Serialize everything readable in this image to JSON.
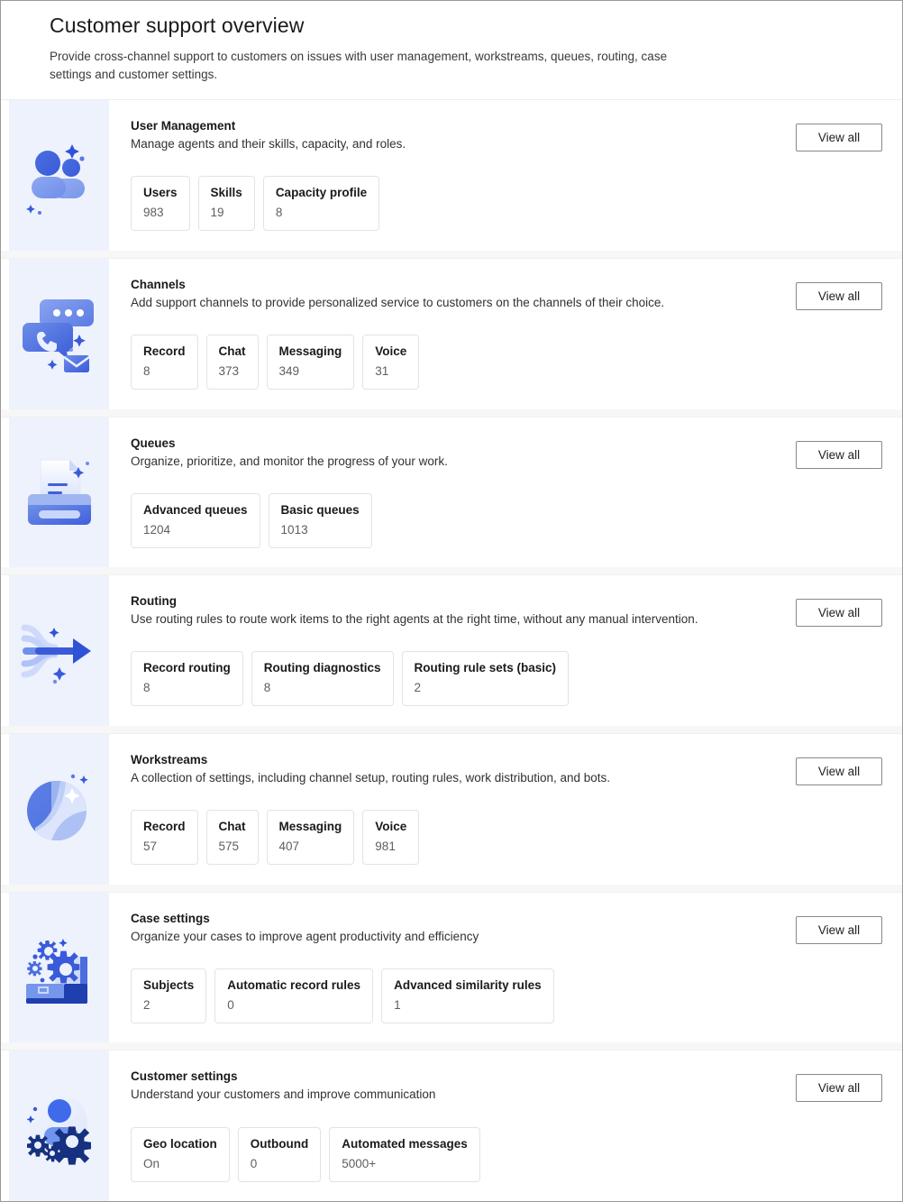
{
  "header": {
    "title": "Customer support overview",
    "subtitle": "Provide cross-channel support to customers on issues with user management, workstreams, queues, routing, case settings and customer settings."
  },
  "colors": {
    "accent": "#3a5bd9",
    "accent_light": "#7e9bf0",
    "icon_panel_bg": "#eef2fd",
    "card_bg": "#ffffff",
    "page_bg": "#f7f7f7",
    "title_text": "#1b1a19",
    "value_text": "#605e5c",
    "tile_border": "#e3e3e3",
    "button_border": "#8a8886"
  },
  "common": {
    "view_all_label": "View all"
  },
  "cards": [
    {
      "id": "user-management",
      "icon": "people-icon",
      "title": "User Management",
      "description": "Manage agents and their skills, capacity, and roles.",
      "view_all_label": "View all",
      "stats": [
        {
          "label": "Users",
          "value": "983"
        },
        {
          "label": "Skills",
          "value": "19"
        },
        {
          "label": "Capacity profile",
          "value": "8"
        }
      ]
    },
    {
      "id": "channels",
      "icon": "chat-call-mail-icon",
      "title": "Channels",
      "description": "Add support channels to provide personalized service to customers on the channels of their choice.",
      "view_all_label": "View all",
      "stats": [
        {
          "label": "Record",
          "value": "8"
        },
        {
          "label": "Chat",
          "value": "373"
        },
        {
          "label": "Messaging",
          "value": "349"
        },
        {
          "label": "Voice",
          "value": "31"
        }
      ]
    },
    {
      "id": "queues",
      "icon": "document-tray-icon",
      "title": "Queues",
      "description": "Organize, prioritize, and monitor the progress of your work.",
      "view_all_label": "View all",
      "stats": [
        {
          "label": "Advanced queues",
          "value": "1204"
        },
        {
          "label": "Basic queues",
          "value": "1013"
        }
      ]
    },
    {
      "id": "routing",
      "icon": "flow-arrow-icon",
      "title": "Routing",
      "description": "Use routing rules to route work items to the right agents at the right time, without any manual intervention.",
      "view_all_label": "View all",
      "stats": [
        {
          "label": "Record routing",
          "value": "8"
        },
        {
          "label": "Routing diagnostics",
          "value": "8"
        },
        {
          "label": "Routing rule sets (basic)",
          "value": "2"
        }
      ]
    },
    {
      "id": "workstreams",
      "icon": "sphere-swirl-icon",
      "title": "Workstreams",
      "description": "A collection of settings, including channel setup, routing rules, work distribution, and bots.",
      "view_all_label": "View all",
      "stats": [
        {
          "label": "Record",
          "value": "57"
        },
        {
          "label": "Chat",
          "value": "575"
        },
        {
          "label": "Messaging",
          "value": "407"
        },
        {
          "label": "Voice",
          "value": "981"
        }
      ]
    },
    {
      "id": "case-settings",
      "icon": "briefcase-gears-icon",
      "title": "Case settings",
      "description": "Organize your cases to improve agent productivity and efficiency",
      "view_all_label": "View all",
      "stats": [
        {
          "label": "Subjects",
          "value": "2"
        },
        {
          "label": "Automatic record rules",
          "value": "0"
        },
        {
          "label": "Advanced similarity rules",
          "value": "1"
        }
      ]
    },
    {
      "id": "customer-settings",
      "icon": "person-gears-icon",
      "title": "Customer settings",
      "description": "Understand your customers and improve communication",
      "view_all_label": "View all",
      "stats": [
        {
          "label": "Geo location",
          "value": "On"
        },
        {
          "label": "Outbound",
          "value": "0"
        },
        {
          "label": "Automated messages",
          "value": "5000+"
        }
      ]
    }
  ]
}
